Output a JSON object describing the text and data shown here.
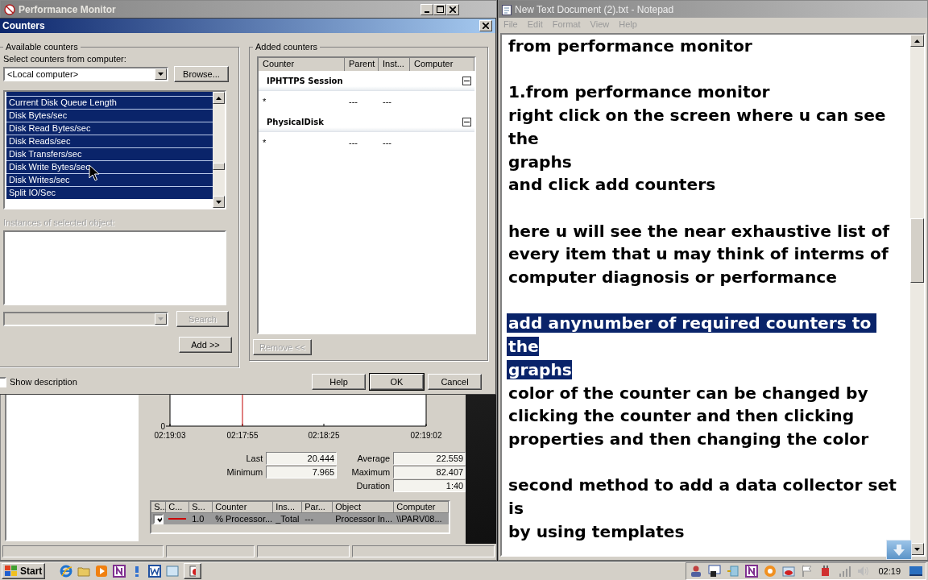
{
  "perfmon": {
    "title": "Performance Monitor",
    "graph": {
      "y_label": "0",
      "x_labels": [
        "02:19:03",
        "02:17:55",
        "02:18:25",
        "02:19:02"
      ]
    },
    "stats": [
      {
        "label": "Last",
        "value": "20.444"
      },
      {
        "label": "Average",
        "value": "22.559"
      },
      {
        "label": "Minimum",
        "value": "7.965"
      },
      {
        "label": "Maximum",
        "value": "82.407"
      },
      {
        "label": "Duration",
        "value": "1:40"
      }
    ],
    "legend": {
      "columns": [
        "S...",
        "C...",
        "S...",
        "Counter",
        "Ins...",
        "Par...",
        "Object",
        "Computer"
      ],
      "rows": [
        {
          "shown": true,
          "color": "#cc0000",
          "selected": true,
          "scale": "1.0",
          "counter": "% Processor...",
          "instance": "_Total",
          "parent": "---",
          "object": "Processor In...",
          "computer": "\\\\PARV08..."
        }
      ]
    }
  },
  "dialog": {
    "title": "Counters",
    "available_group": "Available counters",
    "computer_label": "Select counters from computer:",
    "computer": "<Local computer>",
    "browse": {
      "label": "Browse...",
      "disabled": false
    },
    "counters": [
      {
        "label": "Current Disk Queue Length",
        "selected": true
      },
      {
        "label": "Disk Bytes/sec",
        "selected": true
      },
      {
        "label": "Disk Read Bytes/sec",
        "selected": true
      },
      {
        "label": "Disk Reads/sec",
        "selected": true
      },
      {
        "label": "Disk Transfers/sec",
        "selected": true
      },
      {
        "label": "Disk Write Bytes/sec",
        "selected": true
      },
      {
        "label": "Disk Writes/sec",
        "selected": true
      },
      {
        "label": "Split IO/Sec",
        "selected": true
      }
    ],
    "instances_label": {
      "text": "Instances of selected object:",
      "disabled": true
    },
    "search": {
      "label": "Search",
      "disabled": true
    },
    "add": {
      "label": "Add >>",
      "disabled": false
    },
    "show_description": {
      "label": "Show description",
      "checked": false
    },
    "added_group": "Added counters",
    "added_columns": [
      "Counter",
      "Parent",
      "Inst...",
      "Computer"
    ],
    "added_groups": [
      {
        "name": "IPHTTPS Session",
        "expanded": true,
        "rows": [
          {
            "counter": "*",
            "parent": "---",
            "instance": "---"
          }
        ]
      },
      {
        "name": "PhysicalDisk",
        "expanded": true,
        "rows": [
          {
            "counter": "*",
            "parent": "---",
            "instance": "---"
          }
        ]
      }
    ],
    "remove": {
      "label": "Remove <<",
      "disabled": true
    },
    "buttons": [
      {
        "label": "Help",
        "default": false
      },
      {
        "label": "OK",
        "default": true
      },
      {
        "label": "Cancel",
        "default": false
      }
    ]
  },
  "notepad": {
    "title": "New Text Document (2).txt - Notepad",
    "menu": [
      "File",
      "Edit",
      "Format",
      "View",
      "Help"
    ],
    "paragraphs": [
      [
        {
          "text": "from performance monitor",
          "selected": false
        }
      ],
      [
        {
          "text": "1.from performance monitor",
          "selected": false
        },
        {
          "text": "right click on the screen where u can see",
          "selected": false
        },
        {
          "text": "the",
          "selected": false
        },
        {
          "text": "graphs",
          "selected": false
        },
        {
          "text": "and click add counters",
          "selected": false
        }
      ],
      [
        {
          "text": "here u will see the near exhaustive list of",
          "selected": false
        },
        {
          "text": "every item that u may think of interms of",
          "selected": false
        },
        {
          "text": "computer diagnosis or performance",
          "selected": false
        }
      ],
      [
        {
          "text": "add anynumber of required counters to ",
          "selected": true
        },
        {
          "text": "the",
          "selected": true
        },
        {
          "text": "graphs",
          "selected": true
        },
        {
          "text": "color of the counter can be changed by",
          "selected": false
        },
        {
          "text": "clicking the counter and then clicking",
          "selected": false
        },
        {
          "text": "properties and then changing the color",
          "selected": false
        }
      ],
      [
        {
          "text": "second method to add a data collector set",
          "selected": false
        },
        {
          "text": "is",
          "selected": false
        },
        {
          "text": "by using templates",
          "selected": false
        }
      ]
    ]
  },
  "taskbar": {
    "start": "Start",
    "clock": "02:19"
  }
}
